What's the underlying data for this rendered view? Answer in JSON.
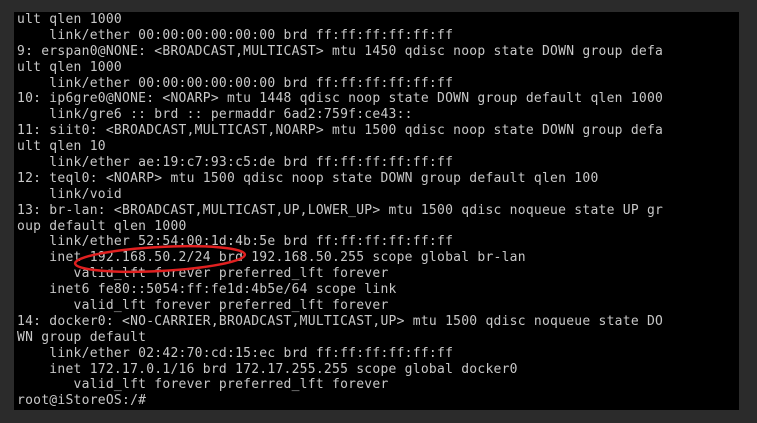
{
  "terminal": {
    "lines": [
      "ult qlen 1000",
      "    link/ether 00:00:00:00:00:00 brd ff:ff:ff:ff:ff:ff",
      "9: erspan0@NONE: <BROADCAST,MULTICAST> mtu 1450 qdisc noop state DOWN group defa",
      "ult qlen 1000",
      "    link/ether 00:00:00:00:00:00 brd ff:ff:ff:ff:ff:ff",
      "10: ip6gre0@NONE: <NOARP> mtu 1448 qdisc noop state DOWN group default qlen 1000",
      "    link/gre6 :: brd :: permaddr 6ad2:759f:ce43::",
      "11: siit0: <BROADCAST,MULTICAST,NOARP> mtu 1500 qdisc noop state DOWN group defa",
      "ult qlen 10",
      "    link/ether ae:19:c7:93:c5:de brd ff:ff:ff:ff:ff:ff",
      "12: teql0: <NOARP> mtu 1500 qdisc noop state DOWN group default qlen 100",
      "    link/void",
      "13: br-lan: <BROADCAST,MULTICAST,UP,LOWER_UP> mtu 1500 qdisc noqueue state UP gr",
      "oup default qlen 1000",
      "    link/ether 52:54:00:1d:4b:5e brd ff:ff:ff:ff:ff:ff",
      "    inet 192.168.50.2/24 brd 192.168.50.255 scope global br-lan",
      "       valid_lft forever preferred_lft forever",
      "    inet6 fe80::5054:ff:fe1d:4b5e/64 scope link",
      "       valid_lft forever preferred_lft forever",
      "14: docker0: <NO-CARRIER,BROADCAST,MULTICAST,UP> mtu 1500 qdisc noqueue state DO",
      "WN group default",
      "    link/ether 02:42:70:cd:15:ec brd ff:ff:ff:ff:ff:ff",
      "    inet 172.17.0.1/16 brd 172.17.255.255 scope global docker0",
      "       valid_lft forever preferred_lft forever",
      "root@iStoreOS:/#"
    ]
  },
  "colors": {
    "window_frame": "#2b2b2b",
    "terminal_bg": "#000000",
    "terminal_fg": "#c8c8c8",
    "annotation": "#e02020"
  }
}
